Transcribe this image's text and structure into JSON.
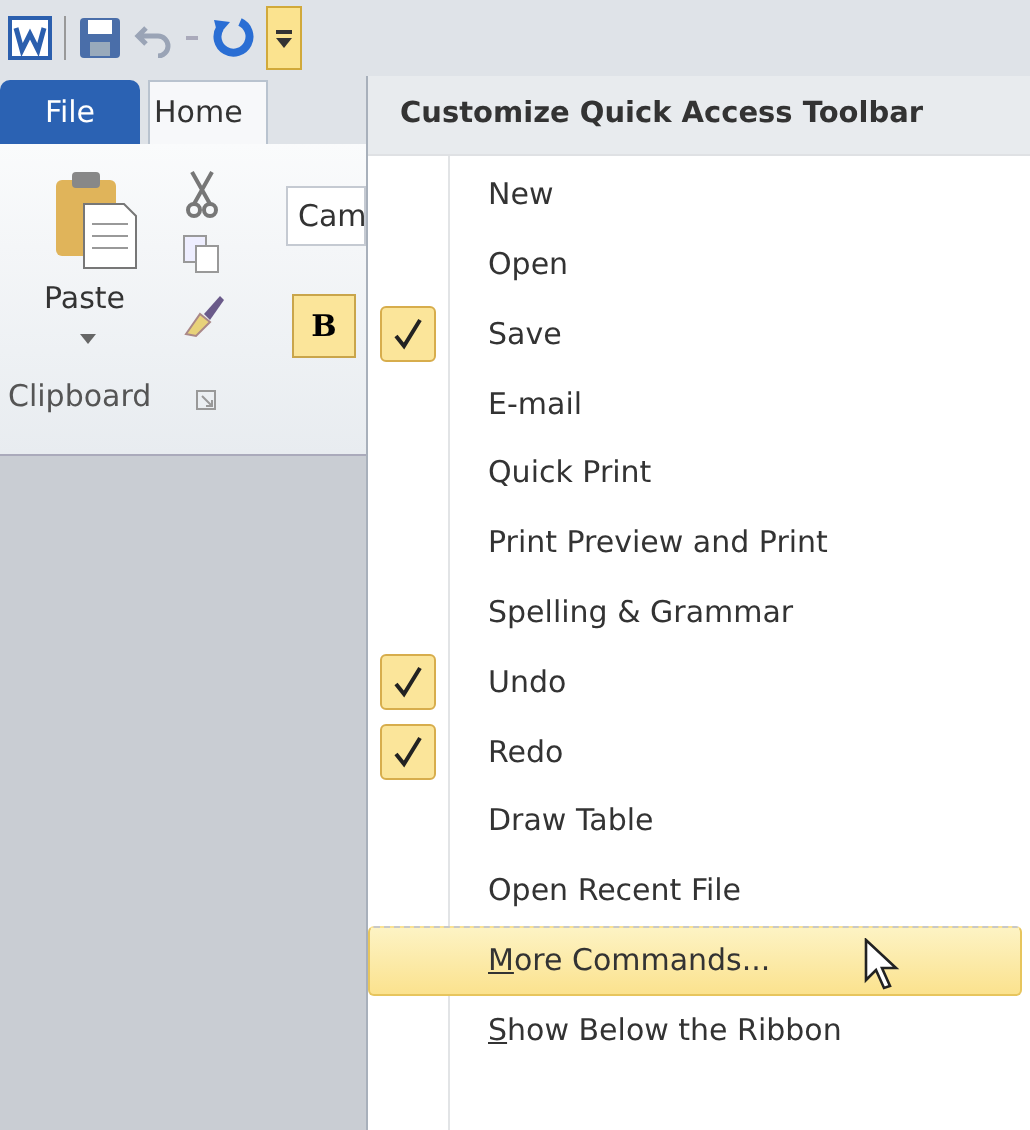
{
  "quick_access_toolbar": {
    "customize_button": {
      "pressed": true
    }
  },
  "ribbon": {
    "tabs": [
      {
        "label": "File",
        "kind": "file",
        "selected": false
      },
      {
        "label": "Home",
        "kind": "tab",
        "selected": true
      }
    ],
    "clipboard_group": {
      "paste_label": "Paste",
      "group_label": "Clipboard"
    },
    "font_box": {
      "value": "Cam"
    },
    "bold_button": {
      "label": "B",
      "active": true
    }
  },
  "menu": {
    "title": "Customize Quick Access Toolbar",
    "items": [
      {
        "label": "New",
        "checked": false
      },
      {
        "label": "Open",
        "checked": false
      },
      {
        "label": "Save",
        "checked": true
      },
      {
        "label": "E-mail",
        "checked": false
      },
      {
        "label": "Quick Print",
        "checked": false
      },
      {
        "label": "Print Preview and Print",
        "checked": false
      },
      {
        "label": "Spelling & Grammar",
        "checked": false
      },
      {
        "label": "Undo",
        "checked": true
      },
      {
        "label": "Redo",
        "checked": true
      },
      {
        "label": "Draw Table",
        "checked": false
      },
      {
        "label": "Open Recent File",
        "checked": false
      },
      {
        "label": "More Commands...",
        "checked": false,
        "mnemonic_first": true,
        "hovered": true,
        "separator_before": true
      },
      {
        "label": "Show Below the Ribbon",
        "checked": false,
        "mnemonic_first": true,
        "hovered": false
      }
    ]
  }
}
